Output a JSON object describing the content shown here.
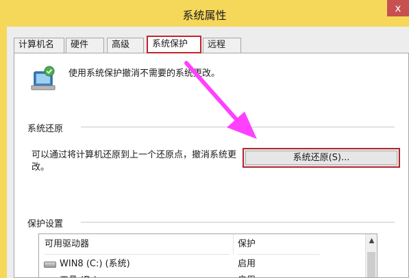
{
  "window": {
    "title": "系统属性",
    "close_glyph": "x"
  },
  "tabs": [
    {
      "label": "计算机名"
    },
    {
      "label": "硬件"
    },
    {
      "label": "高级"
    },
    {
      "label": "系统保护"
    },
    {
      "label": "远程"
    }
  ],
  "intro_text": "使用系统保护撤消不需要的系统更改。",
  "restore": {
    "group_label": "系统还原",
    "description": "可以通过将计算机还原到上一个还原点，撤消系统更改。",
    "button_label": "系统还原(S)..."
  },
  "protection": {
    "group_label": "保护设置",
    "columns": [
      "可用驱动器",
      "保护"
    ],
    "rows": [
      {
        "drive": "WIN8 (C:) (系统)",
        "status": "启用"
      },
      {
        "drive": "工具 (D:)",
        "status": "启用"
      }
    ]
  },
  "colors": {
    "highlight": "#c0242c",
    "annotation_arrow": "#ff40ff",
    "title_bar": "#f5d85a"
  }
}
